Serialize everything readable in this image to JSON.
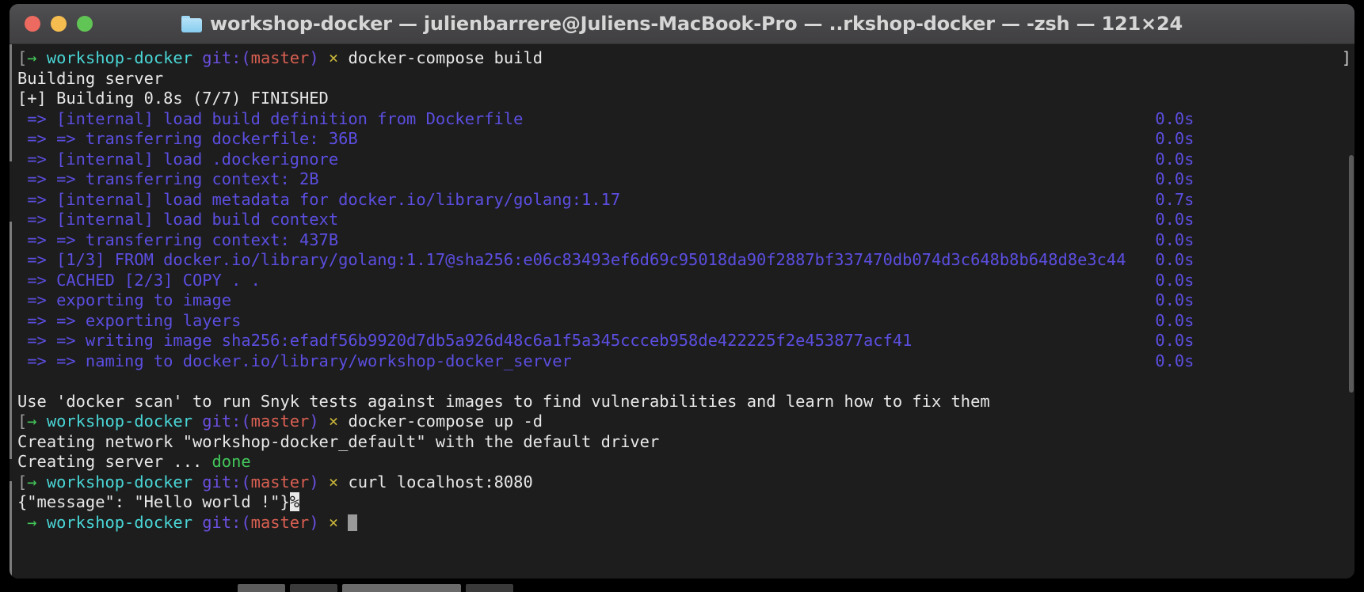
{
  "window": {
    "title": "workshop-docker — julienbarrere@Juliens-MacBook-Pro — ..rkshop-docker — -zsh — 121×24",
    "folder_icon": "folder-icon",
    "traffic_lights": {
      "close": "close-button",
      "minimize": "minimize-button",
      "zoom": "zoom-button"
    },
    "colors": {
      "titlebar": "#474648",
      "terminal_bg": "#1d1d1d",
      "foreground": "#e8e8e8",
      "cyan": "#4ad6d6",
      "violet": "#5d4fe3",
      "red": "#d95f52",
      "yellow": "#c7b43a",
      "green": "#42c75a",
      "build_output": "#5b4ee0",
      "cursor": "#9a9a9a"
    }
  },
  "prompt": {
    "arrow": "→",
    "dir": "workshop-docker",
    "git_open": "git:(",
    "branch": "master",
    "git_close": ")",
    "dirty_mark": "×",
    "left_bracket": "[",
    "right_bracket": "]"
  },
  "terminal": {
    "commands": {
      "build": "docker-compose build",
      "up": "docker-compose up -d",
      "curl": "curl localhost:8080"
    },
    "lines": {
      "building_server": "Building server",
      "building_header": "[+] Building 0.8s (7/7) FINISHED",
      "snyk": "Use 'docker scan' to run Snyk tests against images to find vulnerabilities and learn how to fix them",
      "creating_network": "Creating network \"workshop-docker_default\" with the default driver",
      "creating_server": "Creating server ... ",
      "creating_server_status": "done",
      "curl_response": "{\"message\": \"Hello world !\"}",
      "curl_response_eol": "%"
    },
    "build_steps": [
      {
        "text": " => [internal] load build definition from Dockerfile",
        "time": "0.0s"
      },
      {
        "text": " => => transferring dockerfile: 36B",
        "time": "0.0s"
      },
      {
        "text": " => [internal] load .dockerignore",
        "time": "0.0s"
      },
      {
        "text": " => => transferring context: 2B",
        "time": "0.0s"
      },
      {
        "text": " => [internal] load metadata for docker.io/library/golang:1.17",
        "time": "0.7s"
      },
      {
        "text": " => [internal] load build context",
        "time": "0.0s"
      },
      {
        "text": " => => transferring context: 437B",
        "time": "0.0s"
      },
      {
        "text": " => [1/3] FROM docker.io/library/golang:1.17@sha256:e06c83493ef6d69c95018da90f2887bf337470db074d3c648b8b648d8e3c44",
        "time": "0.0s"
      },
      {
        "text": " => CACHED [2/3] COPY . .",
        "time": "0.0s"
      },
      {
        "text": " => exporting to image",
        "time": "0.0s"
      },
      {
        "text": " => => exporting layers",
        "time": "0.0s"
      },
      {
        "text": " => => writing image sha256:efadf56b9920d7db5a926d48c6a1f5a345ccceb958de422225f2e453877acf41",
        "time": "0.0s"
      },
      {
        "text": " => => naming to docker.io/library/workshop-docker_server",
        "time": "0.0s"
      }
    ]
  }
}
